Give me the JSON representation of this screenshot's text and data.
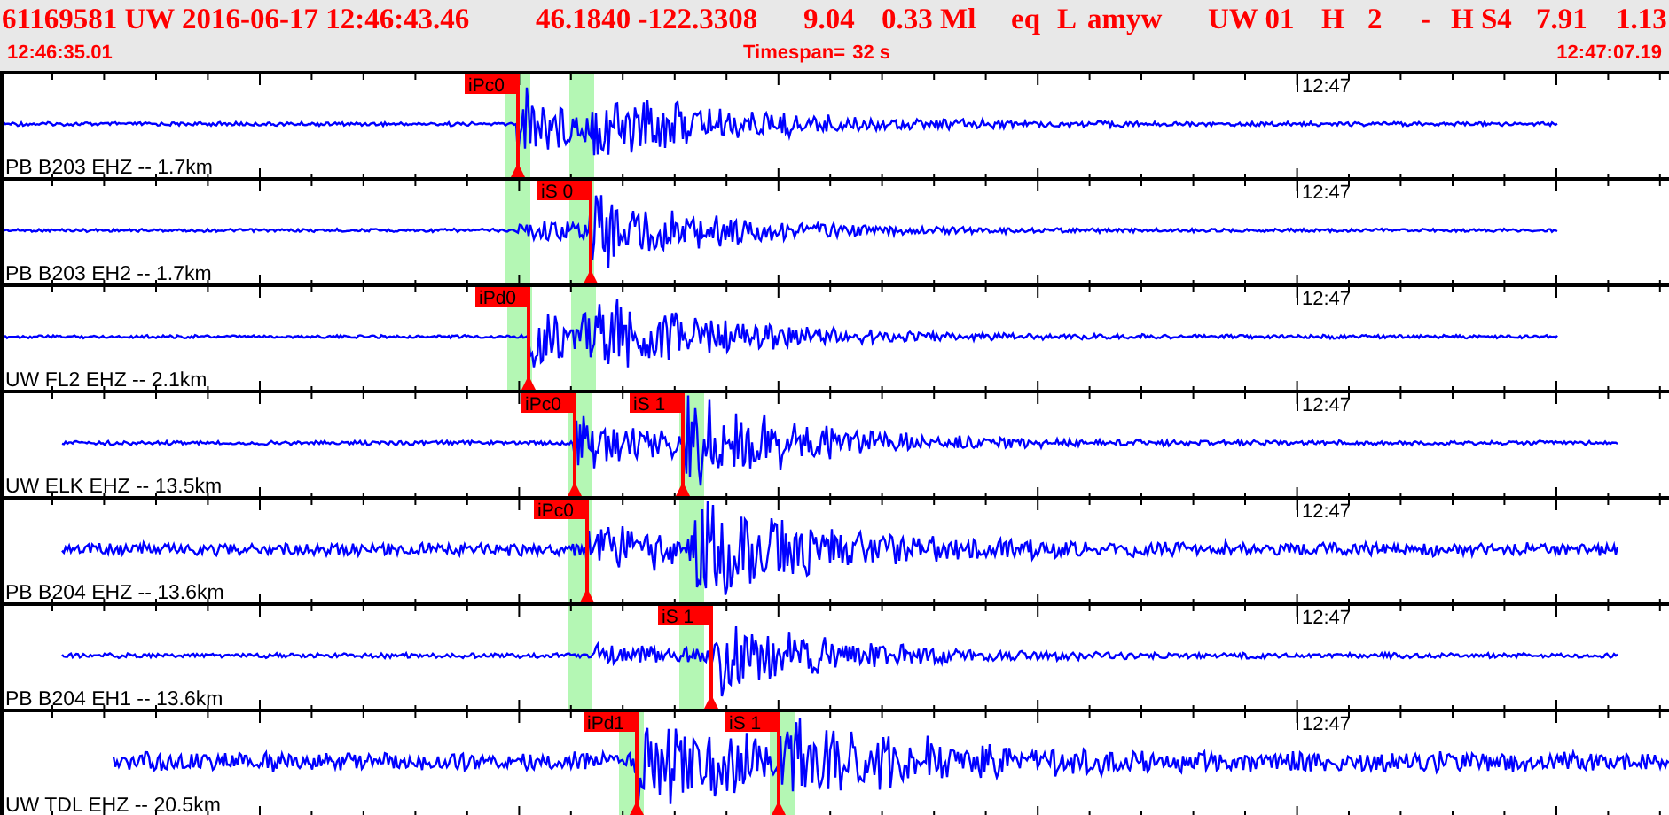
{
  "header": {
    "fields": [
      "61169581 UW 2016-06-17 12:46:43.46",
      "46.1840 -122.3308",
      "9.04",
      "0.33 Ml",
      "eq",
      "L",
      "amyw",
      "UW 01",
      "H",
      "2",
      "-",
      "H S4",
      "7.91",
      "1.13"
    ]
  },
  "time_bar": {
    "start": "12:46:35.01",
    "timespan_label": "Timespan=",
    "timespan_value": "32 s",
    "end": "12:47:07.19"
  },
  "traces": [
    {
      "station": "PB B203 EHZ -- 1.7km",
      "time_marker": "12:47",
      "picks": [
        {
          "label": "iPc0"
        }
      ]
    },
    {
      "station": "PB B203 EH2 -- 1.7km",
      "time_marker": "12:47",
      "picks": [
        {
          "label": "iS 0"
        }
      ]
    },
    {
      "station": "UW FL2 EHZ -- 2.1km",
      "time_marker": "12:47",
      "picks": [
        {
          "label": "iPd0"
        }
      ]
    },
    {
      "station": "UW ELK EHZ -- 13.5km",
      "time_marker": "12:47",
      "picks": [
        {
          "label": "iPc0"
        },
        {
          "label": "iS 1"
        }
      ]
    },
    {
      "station": "PB B204 EHZ -- 13.6km",
      "time_marker": "12:47",
      "picks": [
        {
          "label": "iPc0"
        }
      ]
    },
    {
      "station": "PB B204 EH1 -- 13.6km",
      "time_marker": "12:47",
      "picks": [
        {
          "label": "iS 1"
        }
      ]
    },
    {
      "station": "UW TDL EHZ -- 20.5km",
      "time_marker": "12:47",
      "picks": [
        {
          "label": "iPd1"
        },
        {
          "label": "iS 1"
        }
      ]
    }
  ]
}
